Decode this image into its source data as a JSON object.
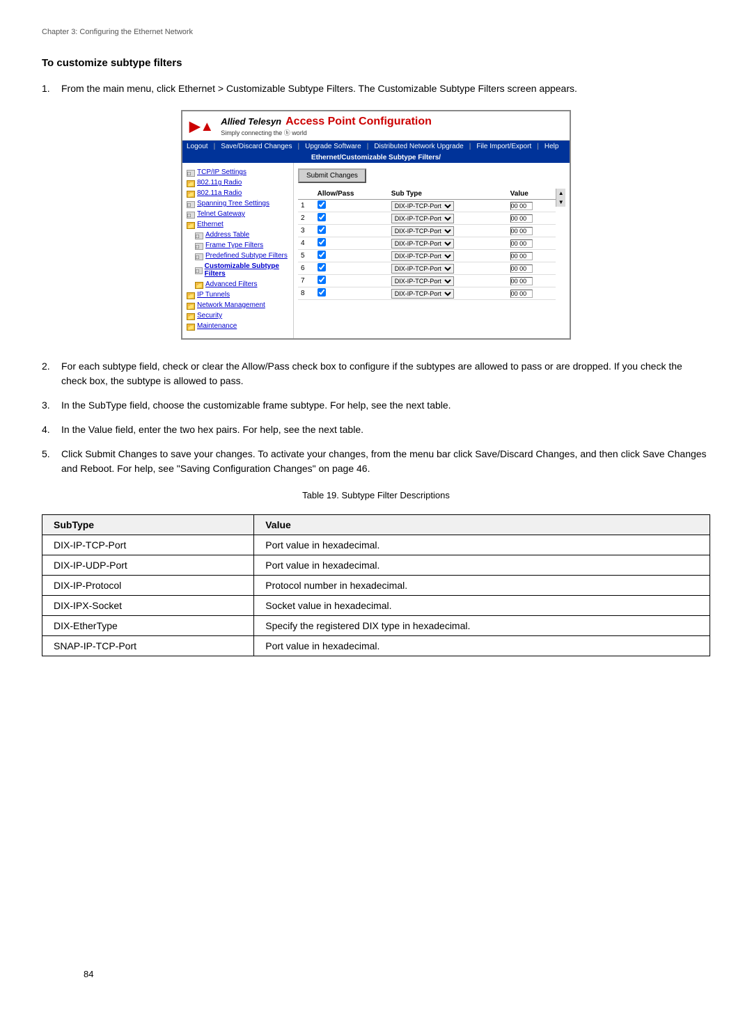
{
  "chapter_header": "Chapter 3: Configuring the Ethernet Network",
  "section_title": "To customize subtype filters",
  "steps": [
    {
      "num": "1.",
      "text": "From the main menu, click Ethernet > Customizable Subtype Filters. The Customizable Subtype Filters screen appears."
    },
    {
      "num": "2.",
      "text": "For each subtype field, check or clear the Allow/Pass check box to configure if the subtypes are allowed to pass or are dropped. If you check the check box, the subtype is allowed to pass."
    },
    {
      "num": "3.",
      "text": "In the SubType field, choose the customizable frame subtype. For help, see the next table."
    },
    {
      "num": "4.",
      "text": "In the Value field, enter the two hex pairs. For help, see the next table."
    },
    {
      "num": "5.",
      "text": "Click Submit Changes to save your changes. To activate your changes, from the menu bar click Save/Discard Changes, and then click Save Changes and Reboot. For help, see \"Saving Configuration Changes\" on page 46."
    }
  ],
  "screen": {
    "logo_brand": "Allied Telesyn",
    "logo_tagline": "Simply connecting the",
    "logo_tagline2": "world",
    "logo_title": "Access Point Configuration",
    "nav_items": [
      "Logout",
      "Save/Discard Changes",
      "Upgrade Software",
      "Distributed Network Upgrade",
      "File Import/Export",
      "Help"
    ],
    "breadcrumb": "Ethernet/Customizable Subtype Filters/",
    "submit_btn": "Submit Changes",
    "table_headers": [
      "",
      "Allow/Pass",
      "Sub Type",
      "Value"
    ],
    "rows": [
      {
        "num": "1",
        "checked": true,
        "subtype": "DIX-IP-TCP-Port",
        "value": "00 00"
      },
      {
        "num": "2",
        "checked": true,
        "subtype": "DIX-IP-TCP-Port",
        "value": "00 00"
      },
      {
        "num": "3",
        "checked": true,
        "subtype": "DIX-IP-TCP-Port",
        "value": "00 00"
      },
      {
        "num": "4",
        "checked": true,
        "subtype": "DIX-IP-TCP-Port",
        "value": "00 00"
      },
      {
        "num": "5",
        "checked": true,
        "subtype": "DIX-IP-TCP-Port",
        "value": "00 00"
      },
      {
        "num": "6",
        "checked": true,
        "subtype": "DIX-IP-TCP-Port",
        "value": "00 00"
      },
      {
        "num": "7",
        "checked": true,
        "subtype": "DIX-IP-TCP-Port",
        "value": "00 00"
      },
      {
        "num": "8",
        "checked": true,
        "subtype": "DIX-IP-TCP-Port",
        "value": "00 00"
      }
    ],
    "sidebar": {
      "items": [
        {
          "label": "TCP/IP Settings",
          "type": "page",
          "indent": 0
        },
        {
          "label": "802.11g Radio",
          "type": "folder",
          "indent": 0
        },
        {
          "label": "802.11a Radio",
          "type": "folder",
          "indent": 0
        },
        {
          "label": "Spanning Tree Settings",
          "type": "page",
          "indent": 0
        },
        {
          "label": "Telnet Gateway",
          "type": "page",
          "indent": 0
        },
        {
          "label": "Ethernet",
          "type": "folder",
          "indent": 0
        },
        {
          "label": "Address Table",
          "type": "page",
          "indent": 1
        },
        {
          "label": "Frame Type Filters",
          "type": "page",
          "indent": 1
        },
        {
          "label": "Predefined Subtype Filters",
          "type": "page",
          "indent": 1
        },
        {
          "label": "Customizable Subtype Filters",
          "type": "page",
          "indent": 1
        },
        {
          "label": "Advanced Filters",
          "type": "folder",
          "indent": 1
        },
        {
          "label": "IP Tunnels",
          "type": "folder",
          "indent": 0
        },
        {
          "label": "Network Management",
          "type": "folder",
          "indent": 0
        },
        {
          "label": "Security",
          "type": "folder",
          "indent": 0
        },
        {
          "label": "Maintenance",
          "type": "folder",
          "indent": 0
        }
      ]
    }
  },
  "table_caption": "Table 19. Subtype Filter Descriptions",
  "desc_table": {
    "col1": "SubType",
    "col2": "Value",
    "rows": [
      {
        "subtype": "DIX-IP-TCP-Port",
        "value": "Port value in hexadecimal."
      },
      {
        "subtype": "DIX-IP-UDP-Port",
        "value": "Port value in hexadecimal."
      },
      {
        "subtype": "DIX-IP-Protocol",
        "value": "Protocol number in hexadecimal."
      },
      {
        "subtype": "DIX-IPX-Socket",
        "value": "Socket value in hexadecimal."
      },
      {
        "subtype": "DIX-EtherType",
        "value": "Specify the registered DIX type in hexadecimal."
      },
      {
        "subtype": "SNAP-IP-TCP-Port",
        "value": "Port value in hexadecimal."
      }
    ]
  },
  "page_number": "84"
}
